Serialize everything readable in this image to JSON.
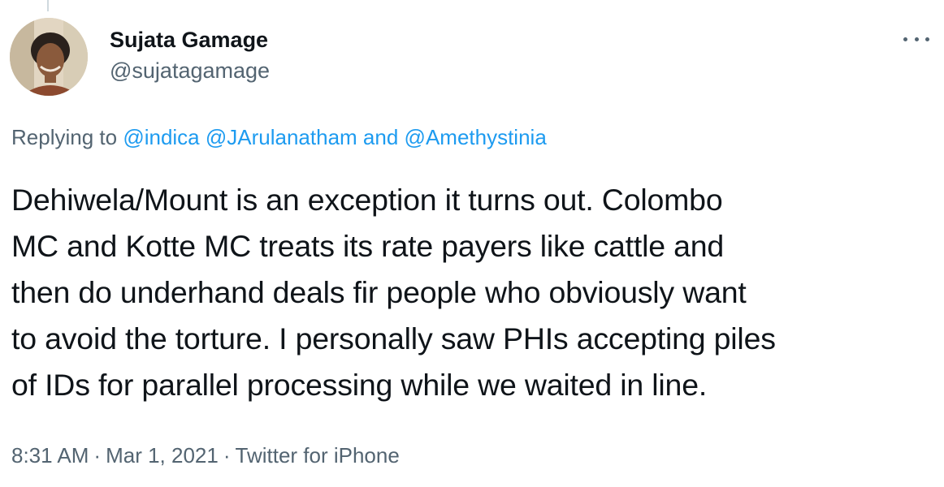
{
  "author": {
    "name": "Sujata Gamage",
    "handle": "@sujatagamage"
  },
  "more_icon": "more-horizontal-icon",
  "reply": {
    "prefix": "Replying to",
    "mention1": "@indica",
    "mention2": "@JArulanatham",
    "conjunction": "and",
    "mention3": "@Amethystinia"
  },
  "tweet": {
    "lines": [
      "Dehiwela/Mount is an exception it turns out. Colombo",
      "MC and Kotte MC treats its rate payers like cattle and",
      "then do underhand deals fir people who obviously want",
      "to avoid the torture. I personally saw PHIs accepting piles",
      "of IDs for parallel processing while we waited in line."
    ]
  },
  "meta": {
    "time": "8:31 AM",
    "separator": "·",
    "date": "Mar 1, 2021",
    "source": "Twitter for iPhone"
  },
  "colors": {
    "text": "#0f1419",
    "secondary": "#536471",
    "link": "#1d9bf0"
  }
}
